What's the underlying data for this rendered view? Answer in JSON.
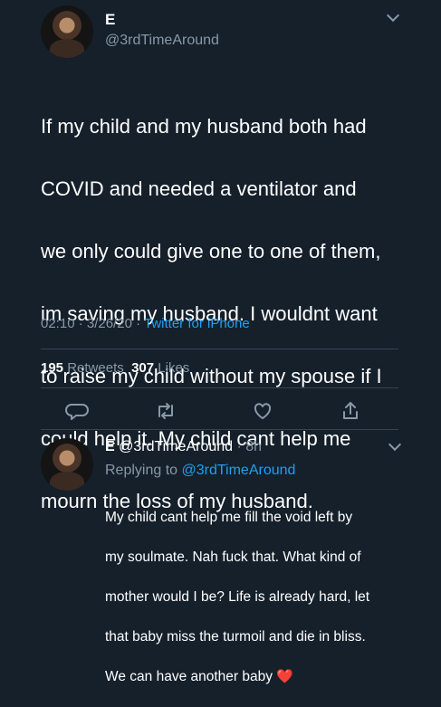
{
  "tweet": {
    "name": "E",
    "handle": "@3rdTimeAround",
    "text_lines": [
      "If my child and my husband both had",
      "COVID and needed a ventilator and",
      "we only could give one to one of them,",
      "im saving my husband. I wouldnt want",
      "to raise my child without my spouse if I",
      "could help it. My child cant help me",
      "mourn the loss of my husband."
    ],
    "time": "02:10 · 3/26/20 · ",
    "client": "Twitter for iPhone",
    "retweets_count": "195",
    "retweets_label": "Retweets",
    "likes_count": "307",
    "likes_label": "Likes",
    "actions": [
      "reply-icon",
      "retweet-icon",
      "like-icon",
      "share-icon"
    ]
  },
  "reply": {
    "name": "E",
    "handle": "@3rdTimeAround",
    "time": " · 8h",
    "replying_prefix": "Replying to ",
    "replying_to": "@3rdTimeAround",
    "text_lines": [
      "My child cant help me fill the void left by",
      "my soulmate. Nah fuck that. What kind of",
      "mother would I be? Life is already hard, let",
      "that baby miss the turmoil and die in bliss.",
      "We can have another baby "
    ],
    "emoji": "❤️"
  },
  "colors": {
    "background": "#15202b",
    "secondary_text": "#8899a6",
    "link": "#1da1f2",
    "divider": "#38444d"
  }
}
